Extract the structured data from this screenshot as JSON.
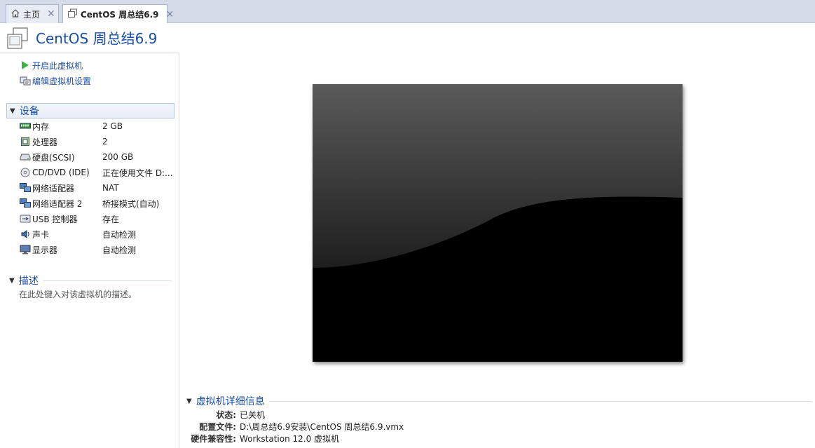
{
  "tabs": [
    {
      "label": "主页",
      "icon": "home-icon",
      "active": false
    },
    {
      "label": "CentOS 周总结6.9",
      "icon": "vm-icon",
      "active": true
    }
  ],
  "title": "CentOS 周总结6.9",
  "actions": [
    {
      "label": "开启此虚拟机",
      "icon": "play-icon"
    },
    {
      "label": "编辑虚拟机设置",
      "icon": "edit-settings-icon"
    }
  ],
  "devices_section": {
    "label": "设备"
  },
  "devices": [
    {
      "name": "内存",
      "value": "2 GB",
      "icon": "memory-icon"
    },
    {
      "name": "处理器",
      "value": "2",
      "icon": "processor-icon"
    },
    {
      "name": "硬盘(SCSI)",
      "value": "200 GB",
      "icon": "harddisk-icon"
    },
    {
      "name": "CD/DVD (IDE)",
      "value": "正在使用文件 D:...",
      "icon": "cd-dvd-icon"
    },
    {
      "name": "网络适配器",
      "value": "NAT",
      "icon": "network-adapter-icon"
    },
    {
      "name": "网络适配器 2",
      "value": "桥接模式(自动)",
      "icon": "network-adapter-icon"
    },
    {
      "name": "USB 控制器",
      "value": "存在",
      "icon": "usb-icon"
    },
    {
      "name": "声卡",
      "value": "自动检测",
      "icon": "sound-card-icon"
    },
    {
      "name": "显示器",
      "value": "自动检测",
      "icon": "display-icon"
    }
  ],
  "description_section": {
    "label": "描述",
    "placeholder": "在此处键入对该虚拟机的描述。"
  },
  "details_section": {
    "label": "虚拟机详细信息",
    "rows": [
      {
        "key": "状态:",
        "value": "已关机"
      },
      {
        "key": "配置文件:",
        "value": "D:\\周总结6.9安装\\CentOS 周总结6.9.vmx"
      },
      {
        "key": "硬件兼容性:",
        "value": "Workstation 12.0 虚拟机"
      }
    ]
  },
  "colors": {
    "accent": "#1b4fa8",
    "tabstrip": "#d6dbe9",
    "play": "#3cb53c"
  }
}
